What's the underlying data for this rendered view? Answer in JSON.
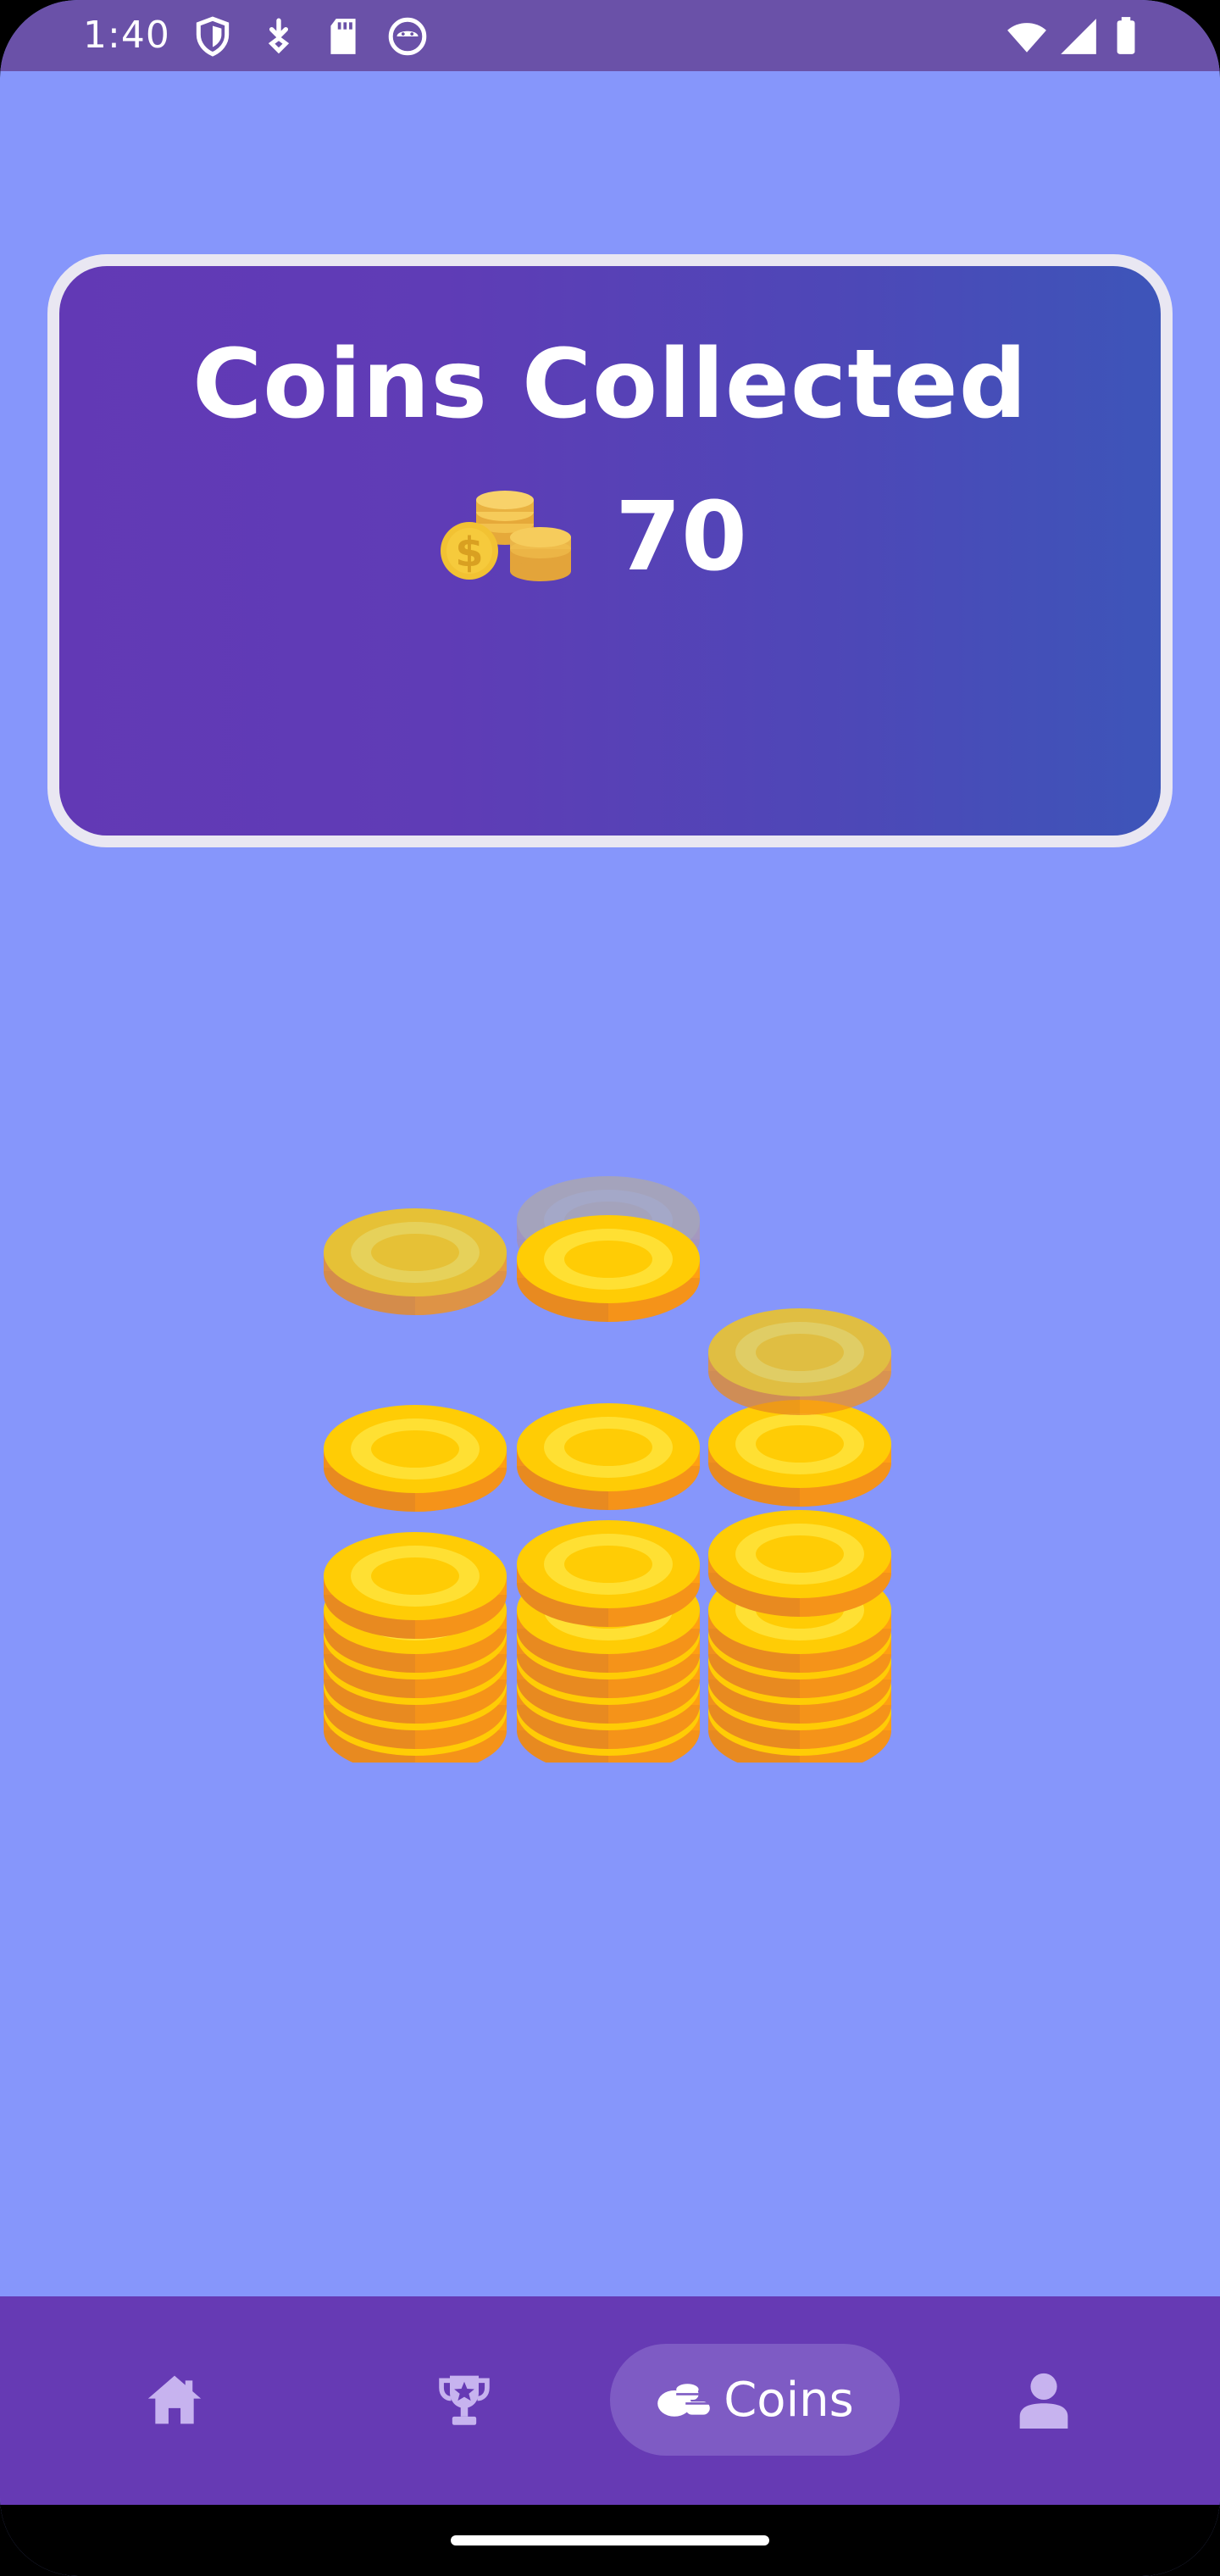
{
  "status_bar": {
    "time": "1:40",
    "left_icons": [
      "shield-icon",
      "download-icon",
      "sd-card-icon",
      "android-face-icon"
    ],
    "right_icons": [
      "wifi-icon",
      "signal-icon",
      "battery-icon"
    ]
  },
  "header_card": {
    "title": "Coins Collected",
    "coin_count": "70",
    "icon": "coins-stack-icon"
  },
  "bottom_nav": {
    "items": [
      {
        "id": "home",
        "icon": "home-icon",
        "label": "",
        "selected": false
      },
      {
        "id": "trophy",
        "icon": "trophy-icon",
        "label": "",
        "selected": false
      },
      {
        "id": "coins",
        "icon": "coins-icon",
        "label": "Coins",
        "selected": true
      },
      {
        "id": "profile",
        "icon": "person-icon",
        "label": "",
        "selected": false
      }
    ]
  },
  "colors": {
    "background": "#8696fb",
    "status_bar": "#6a51a8",
    "nav_bar": "#663ab4",
    "nav_selected_pill": "#7e5bc4",
    "nav_icon_inactive": "#c9b6f0",
    "coin_gold": "#ffcc00",
    "coin_edge": "#ff9a1a"
  }
}
